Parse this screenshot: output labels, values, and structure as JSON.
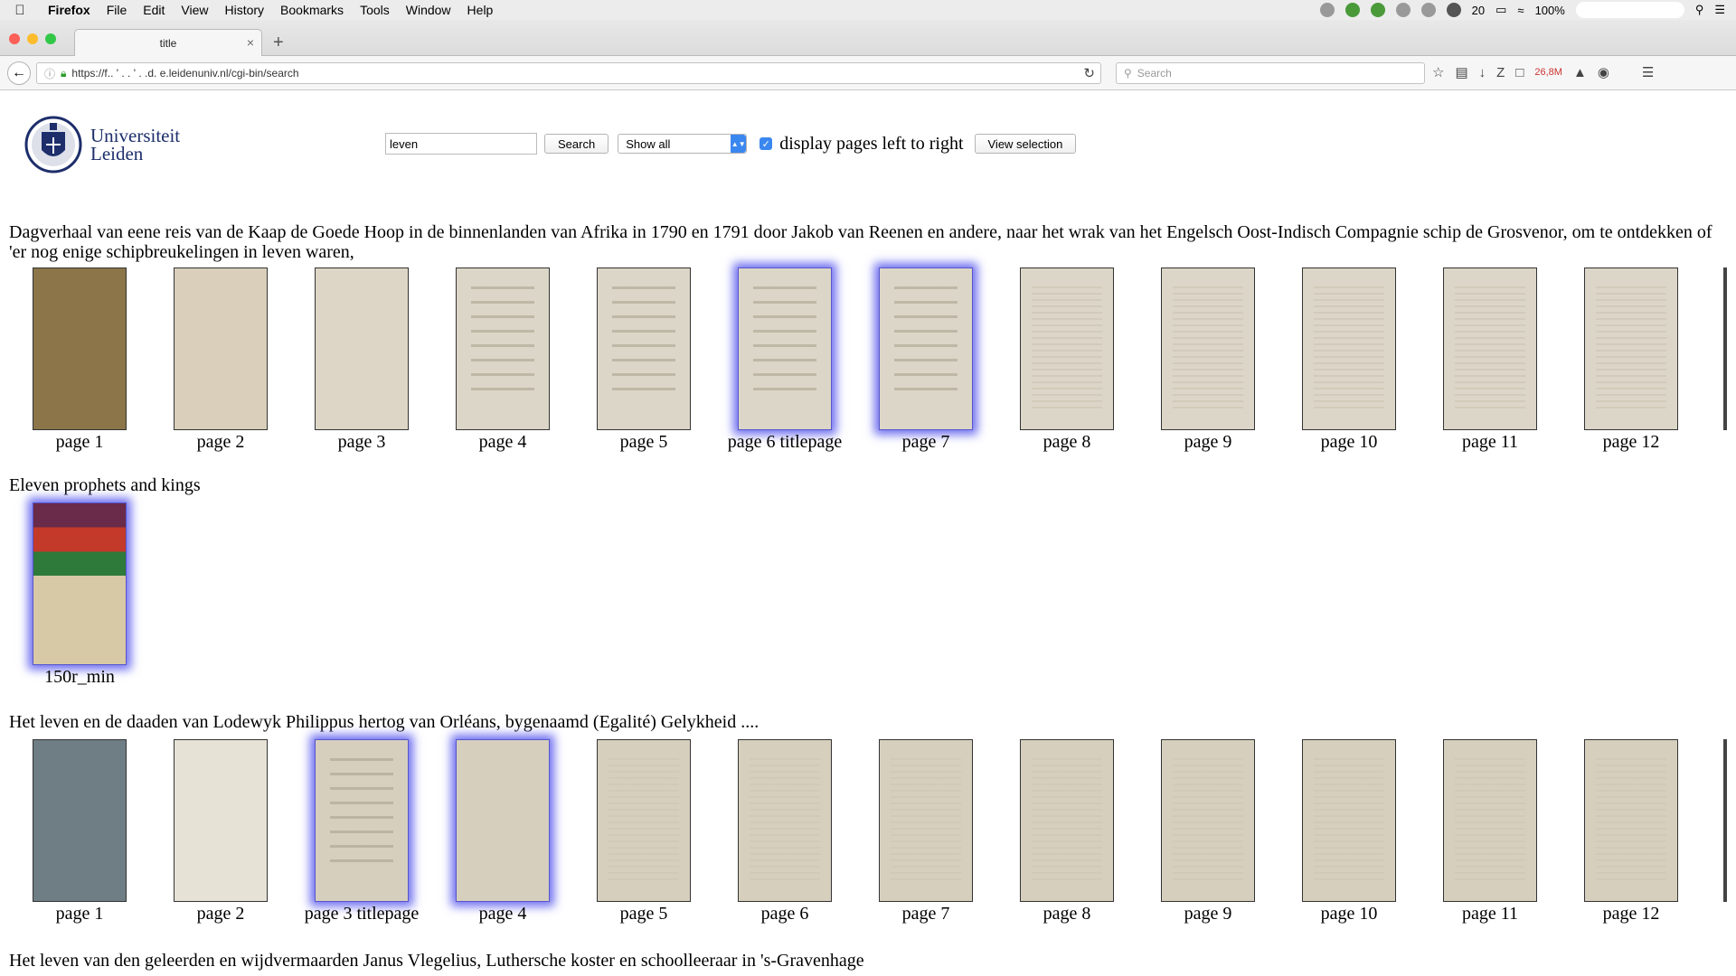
{
  "menubar": {
    "app": "Firefox",
    "items": [
      "File",
      "Edit",
      "View",
      "History",
      "Bookmarks",
      "Tools",
      "Window",
      "Help"
    ],
    "status_count": "20",
    "battery": "100%"
  },
  "tab": {
    "title": "title",
    "close": "×",
    "new": "+"
  },
  "nav": {
    "url": "https://f.. ' . . ' . .d. e.leidenuniv.nl/cgi-bin/search",
    "search_placeholder": "Search",
    "memory": "26,8M"
  },
  "logo": {
    "line1": "Universiteit",
    "line2": "Leiden"
  },
  "form": {
    "query": "leven",
    "search_button": "Search",
    "select_value": "Show all",
    "checkbox_label": "display pages left to right",
    "view_selection": "View selection"
  },
  "results": [
    {
      "title": "Dagverhaal van eene reis van de Kaap de Goede Hoop in de binnenlanden van Afrika in 1790 en 1791 door Jakob van Reenen en andere, naar het wrak van het Engelsch Oost-Indisch Compagnie schip de Grosvenor, om te ontdekken of 'er nog enige schipbreukelingen in leven waren,",
      "pages": [
        {
          "label": "page 1",
          "tone": "#8b7549",
          "hl": false,
          "kind": "cover"
        },
        {
          "label": "page 2",
          "tone": "#d9cfba",
          "hl": false,
          "kind": "blank"
        },
        {
          "label": "page 3",
          "tone": "#ddd6c6",
          "hl": false,
          "kind": "blank"
        },
        {
          "label": "page 4",
          "tone": "#dcd6c8",
          "hl": false,
          "kind": "title"
        },
        {
          "label": "page 5",
          "tone": "#dcd6c8",
          "hl": false,
          "kind": "title"
        },
        {
          "label": "page 6 titlepage",
          "tone": "#dcd6c8",
          "hl": true,
          "kind": "title"
        },
        {
          "label": "page 7",
          "tone": "#dcd6c8",
          "hl": true,
          "kind": "title"
        },
        {
          "label": "page 8",
          "tone": "#dcd6c8",
          "hl": false,
          "kind": "text"
        },
        {
          "label": "page 9",
          "tone": "#dcd6c8",
          "hl": false,
          "kind": "text"
        },
        {
          "label": "page 10",
          "tone": "#dcd6c8",
          "hl": false,
          "kind": "text"
        },
        {
          "label": "page 11",
          "tone": "#dcd6c8",
          "hl": false,
          "kind": "text"
        },
        {
          "label": "page 12",
          "tone": "#dcd6c8",
          "hl": false,
          "kind": "text"
        }
      ]
    },
    {
      "title": "Eleven prophets and kings",
      "pages": [
        {
          "label": "150r_min",
          "tone": "#b9a37a",
          "hl": true,
          "kind": "miniature"
        }
      ]
    },
    {
      "title": "Het leven en de daaden van Lodewyk Philippus hertog van Orléans, bygenaamd (Egalité) Gelykheid ....",
      "pages": [
        {
          "label": "page 1",
          "tone": "#6f7e84",
          "hl": false,
          "kind": "cover"
        },
        {
          "label": "page 2",
          "tone": "#e6e2d6",
          "hl": false,
          "kind": "blank"
        },
        {
          "label": "page 3 titlepage",
          "tone": "#d6cfbe",
          "hl": true,
          "kind": "title"
        },
        {
          "label": "page 4",
          "tone": "#d6cfbe",
          "hl": true,
          "kind": "blank"
        },
        {
          "label": "page 5",
          "tone": "#d6cfbe",
          "hl": false,
          "kind": "text"
        },
        {
          "label": "page 6",
          "tone": "#d6cfbe",
          "hl": false,
          "kind": "text"
        },
        {
          "label": "page 7",
          "tone": "#d6cfbe",
          "hl": false,
          "kind": "text"
        },
        {
          "label": "page 8",
          "tone": "#d6cfbe",
          "hl": false,
          "kind": "text"
        },
        {
          "label": "page 9",
          "tone": "#d6cfbe",
          "hl": false,
          "kind": "text"
        },
        {
          "label": "page 10",
          "tone": "#d6cfbe",
          "hl": false,
          "kind": "text"
        },
        {
          "label": "page 11",
          "tone": "#d6cfbe",
          "hl": false,
          "kind": "text"
        },
        {
          "label": "page 12",
          "tone": "#d6cfbe",
          "hl": false,
          "kind": "text"
        }
      ]
    },
    {
      "title": "Het leven van den geleerden en wijdvermaarden Janus Vlegelius, Luthersche koster en schoolleeraar in 's-Gravenhage",
      "pages": []
    }
  ]
}
